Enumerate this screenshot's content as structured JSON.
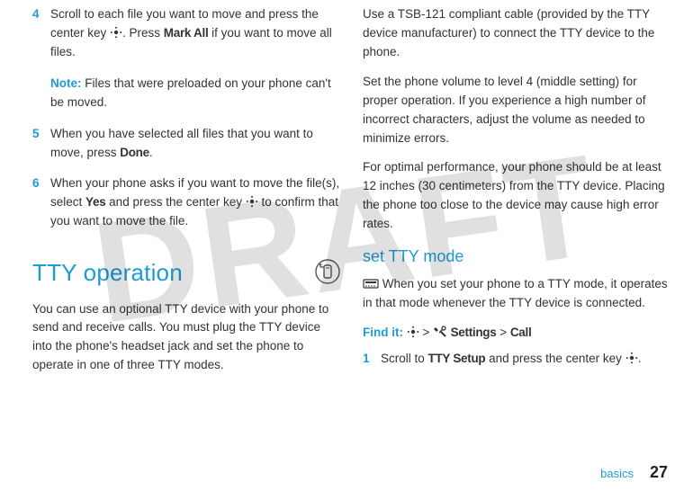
{
  "watermark": "DRAFT",
  "left": {
    "step4": {
      "num": "4",
      "text_a": "Scroll to each file you want to move and press the center key ",
      "text_b": ". Press ",
      "mark_all": "Mark All",
      "text_c": " if you want to move all files."
    },
    "note": {
      "label": "Note:",
      "text": " Files that were preloaded on your phone can't be moved."
    },
    "step5": {
      "num": "5",
      "text_a": "When you have selected all files that you want to move, press ",
      "done": "Done",
      "text_b": "."
    },
    "step6": {
      "num": "6",
      "text_a": "When your phone asks if you want to move the file(s), select ",
      "yes": "Yes",
      "text_b": " and press the center key ",
      "text_c": " to confirm that you want to move the file."
    },
    "h1": "TTY operation",
    "intro": "You can use an optional TTY device with your phone to send and receive calls. You must plug the TTY device into the phone's headset jack and set the phone to operate in one of three TTY modes."
  },
  "right": {
    "p1": "Use a TSB-121 compliant cable (provided by the TTY device manufacturer) to connect the TTY device to the phone.",
    "p2": "Set the phone volume to level 4 (middle setting) for proper operation. If you experience a high number of incorrect characters, adjust the volume as needed to minimize errors.",
    "p3": "For optimal performance, your phone should be at least 12 inches (30 centimeters) from the TTY device. Placing the phone too close to the device may cause high error rates.",
    "h2": "set TTY mode",
    "set_intro": " When you set your phone to a TTY mode, it operates in that mode whenever the TTY device is connected.",
    "findit": {
      "label": "Find it:",
      "gt1": " > ",
      "settings": " Settings",
      "gt2": " > ",
      "call": "Call"
    },
    "step1": {
      "num": "1",
      "text_a": "Scroll to ",
      "ttysetup": "TTY Setup",
      "text_b": " and press the center key ",
      "text_c": "."
    }
  },
  "footer": {
    "section": "basics",
    "page": "27"
  }
}
